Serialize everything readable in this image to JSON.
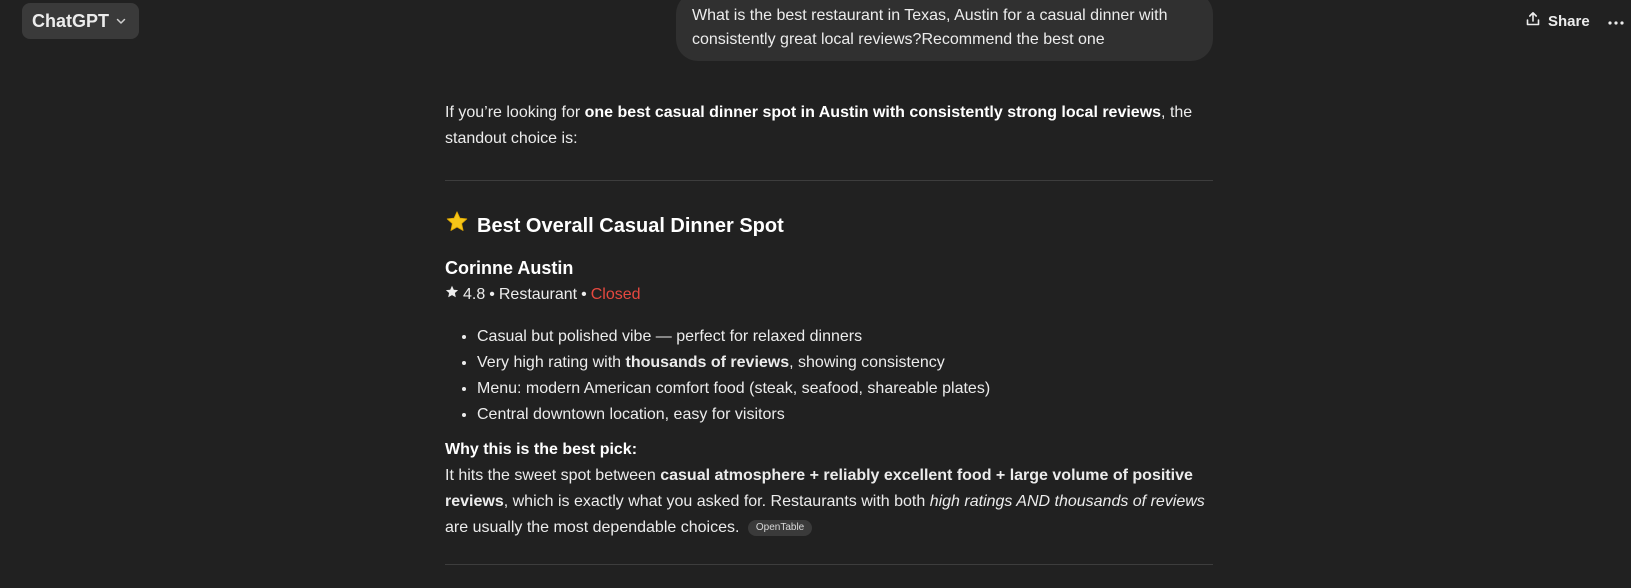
{
  "header": {
    "model_label": "ChatGPT",
    "share_label": "Share"
  },
  "user_message": "What is the best restaurant in Texas, Austin for a casual dinner with consistently great local reviews?Recommend the best one",
  "response": {
    "intro_pre": "If you’re looking for ",
    "intro_bold": "one best casual dinner spot in Austin with consistently strong local reviews",
    "intro_post": ", the standout choice is:",
    "section_title": "Best Overall Casual Dinner Spot",
    "place": {
      "name": "Corinne Austin",
      "rating": "4.8",
      "category": "Restaurant",
      "status": "Closed",
      "separator": "•"
    },
    "bullets": [
      {
        "pre": "Casual but polished vibe — perfect for relaxed dinners",
        "bold": "",
        "post": ""
      },
      {
        "pre": "Very high rating with ",
        "bold": "thousands of reviews",
        "post": ", showing consistency"
      },
      {
        "pre": "Menu: modern American comfort food (steak, seafood, shareable plates)",
        "bold": "",
        "post": ""
      },
      {
        "pre": "Central downtown location, easy for visitors",
        "bold": "",
        "post": ""
      }
    ],
    "why_title": "Why this is the best pick:",
    "why_pre": "It hits the sweet spot between ",
    "why_bold": "casual atmosphere + reliably excellent food + large volume of positive reviews",
    "why_mid": ", which is exactly what you asked for. Restaurants with both ",
    "why_italic": "high ratings AND thousands of reviews",
    "why_post": " are usually the most dependable choices.",
    "source_chip": "OpenTable"
  },
  "colors": {
    "background": "#212121",
    "bubble": "#303030",
    "closed_status": "#e5483f",
    "star_emoji": "#f5c518"
  },
  "icons": {
    "model_chevron": "chevron-down-icon",
    "share": "share-icon",
    "more": "more-horizontal-icon",
    "section_star": "star-emoji-icon",
    "rating_star": "rating-star-icon"
  }
}
